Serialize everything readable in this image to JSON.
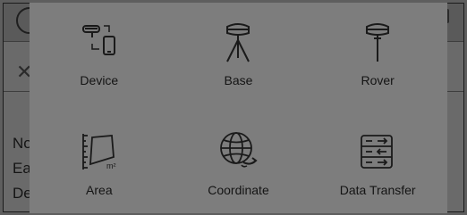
{
  "menu": {
    "items": [
      {
        "label": "Device",
        "icon": "device-icon"
      },
      {
        "label": "Base",
        "icon": "base-icon"
      },
      {
        "label": "Rover",
        "icon": "rover-icon"
      },
      {
        "label": "Area",
        "icon": "area-icon"
      },
      {
        "label": "Coordinate",
        "icon": "coordinate-icon"
      },
      {
        "label": "Data Transfer",
        "icon": "data-transfer-icon"
      }
    ]
  },
  "background": {
    "rows": [
      "No",
      "Ea",
      "De"
    ]
  },
  "colors": {
    "panel": "#7d7d7d",
    "icon_stroke": "#1a1a1a"
  }
}
